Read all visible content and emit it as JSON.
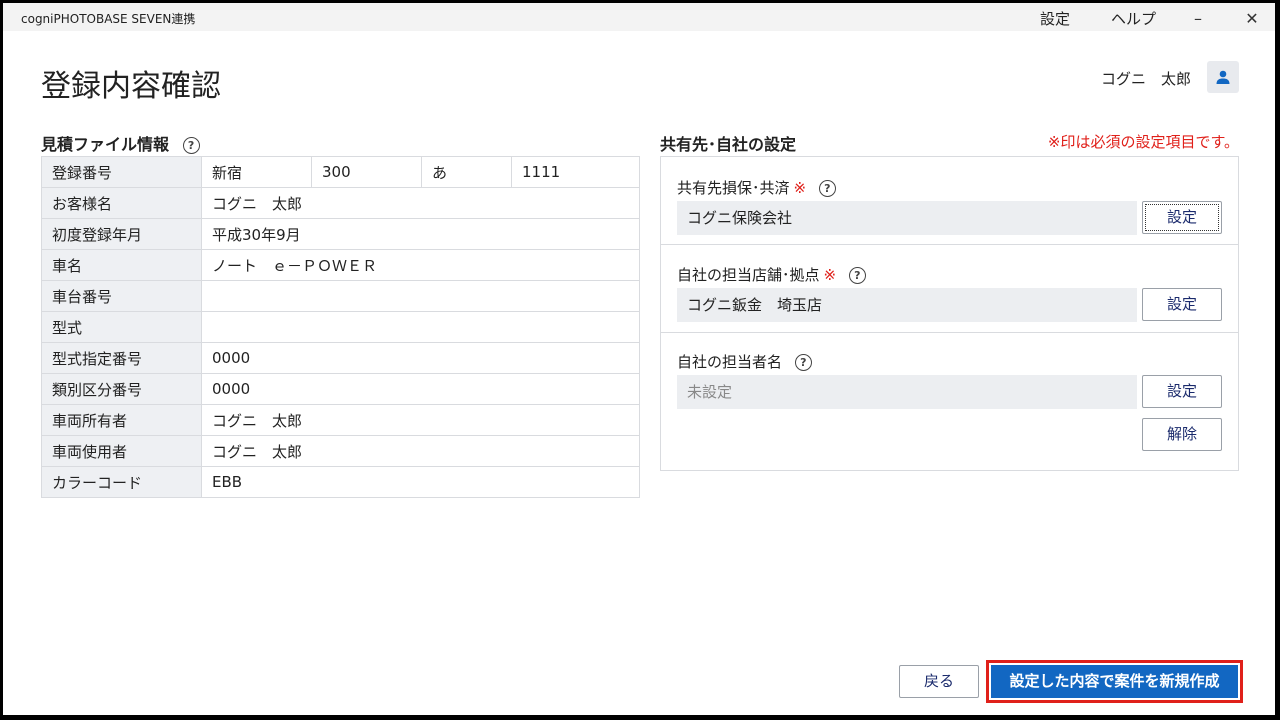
{
  "app": {
    "title": "cogniPHOTOBASE SEVEN連携",
    "menu": {
      "settings": "設定",
      "help": "ヘルプ"
    },
    "minimize": "–",
    "close": "✕"
  },
  "header": {
    "page_title": "登録内容確認",
    "user_name": "コグニ　太郎"
  },
  "estimate": {
    "section_title": "見積ファイル情報",
    "help": "?",
    "registration": {
      "label": "登録番号",
      "parts": [
        "新宿",
        "300",
        "あ",
        "1111"
      ]
    },
    "rows": [
      {
        "label": "お客様名",
        "value": "コグニ　太郎"
      },
      {
        "label": "初度登録年月",
        "value": "平成30年9月"
      },
      {
        "label": "車名",
        "value": "ノート　ｅ－ＰＯＷＥＲ"
      },
      {
        "label": "車台番号",
        "value": ""
      },
      {
        "label": "型式",
        "value": ""
      },
      {
        "label": "型式指定番号",
        "value": "0000"
      },
      {
        "label": "類別区分番号",
        "value": "0000"
      },
      {
        "label": "車両所有者",
        "value": "コグニ　太郎"
      },
      {
        "label": "車両使用者",
        "value": "コグニ　太郎"
      },
      {
        "label": "カラーコード",
        "value": "EBB"
      }
    ]
  },
  "sharing": {
    "section_title": "共有先･自社の設定",
    "required_note": "※印は必須の設定項目です。",
    "required_mark": "※",
    "help": "?",
    "insurer": {
      "label": "共有先損保･共済",
      "value": "コグニ保険会社",
      "button": "設定"
    },
    "store": {
      "label": "自社の担当店舗･拠点",
      "value": "コグニ鈑金　埼玉店",
      "button": "設定"
    },
    "staff": {
      "label": "自社の担当者名",
      "value": "未設定",
      "button": "設定",
      "clear_button": "解除"
    }
  },
  "footer": {
    "back": "戻る",
    "create": "設定した内容で案件を新規作成"
  },
  "colors": {
    "primary": "#1267c2",
    "required": "#e0201a",
    "label_bg": "#eef0f3"
  }
}
